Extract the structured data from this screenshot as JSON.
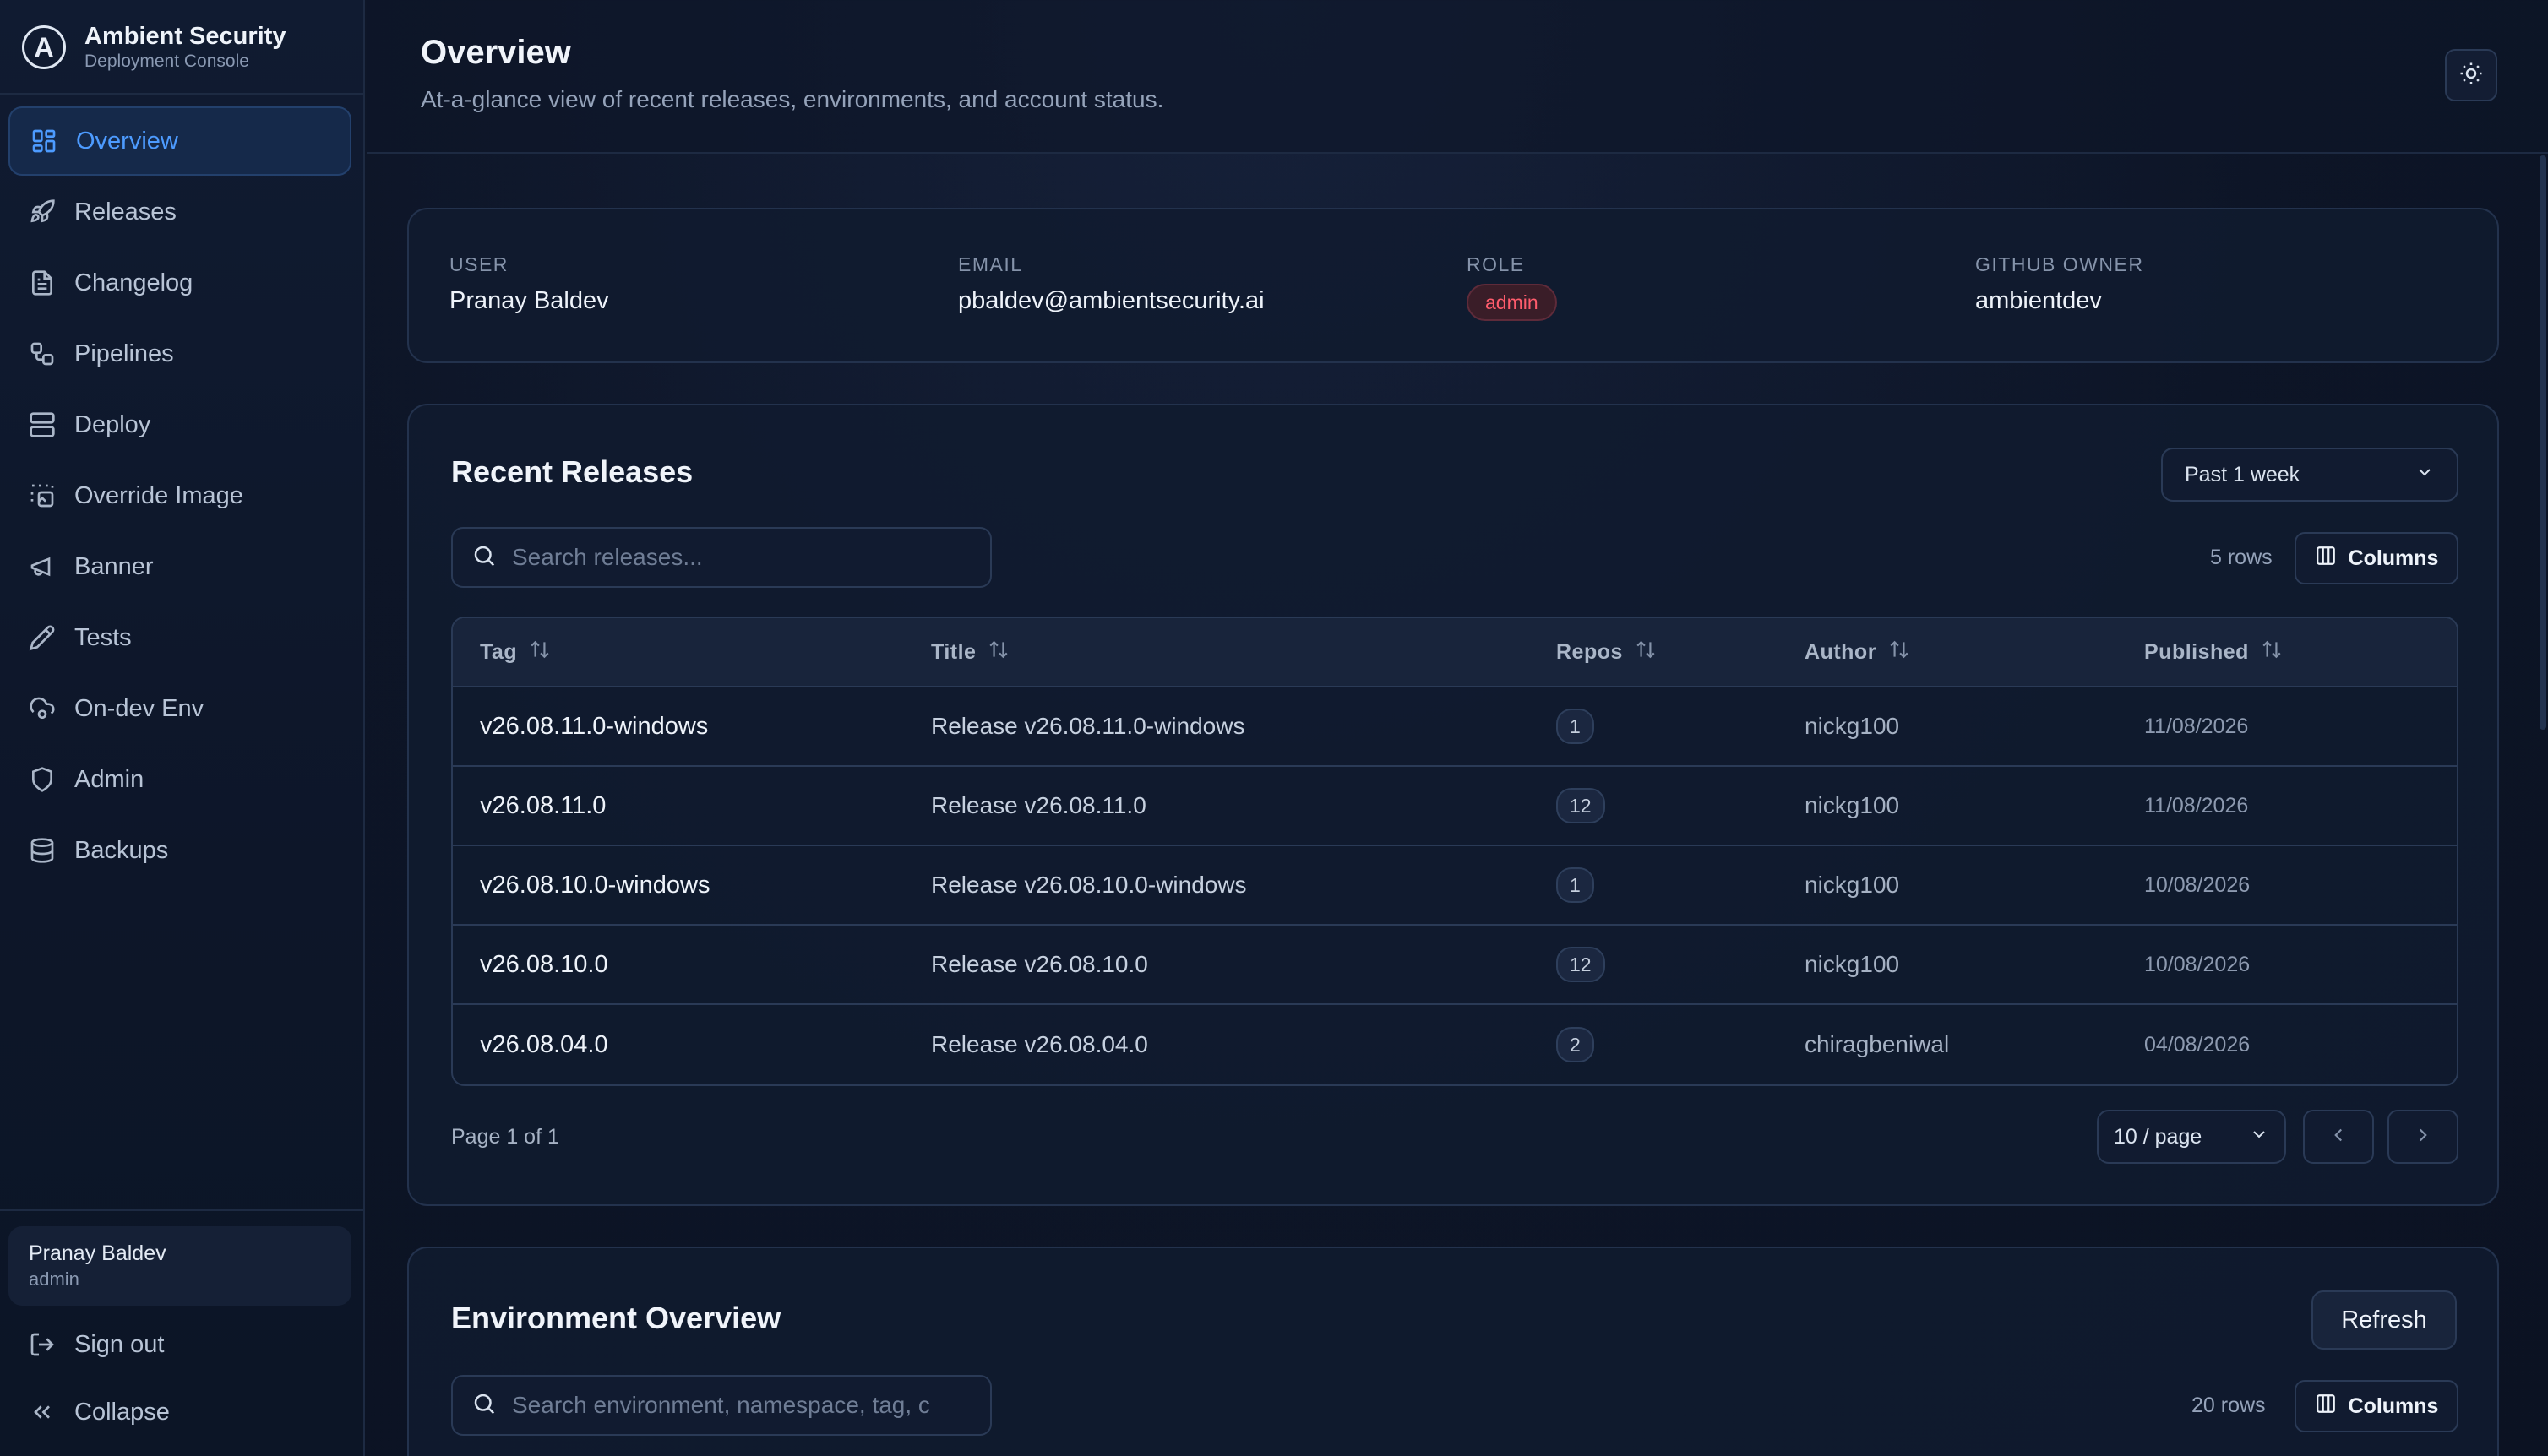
{
  "brand": {
    "logo_letter": "A",
    "name": "Ambient Security",
    "subtitle": "Deployment Console"
  },
  "sidebar": {
    "items": [
      {
        "label": "Overview",
        "icon": "grid-icon",
        "active": true
      },
      {
        "label": "Releases",
        "icon": "rocket-icon"
      },
      {
        "label": "Changelog",
        "icon": "file-text-icon"
      },
      {
        "label": "Pipelines",
        "icon": "workflow-icon"
      },
      {
        "label": "Deploy",
        "icon": "server-icon"
      },
      {
        "label": "Override Image",
        "icon": "image-select-icon"
      },
      {
        "label": "Banner",
        "icon": "megaphone-icon"
      },
      {
        "label": "Tests",
        "icon": "pencil-icon"
      },
      {
        "label": "On-dev Env",
        "icon": "cloud-cog-icon"
      },
      {
        "label": "Admin",
        "icon": "shield-icon"
      },
      {
        "label": "Backups",
        "icon": "database-icon"
      }
    ],
    "user": {
      "name": "Pranay Baldev",
      "role": "admin"
    },
    "sign_out": "Sign out",
    "collapse": "Collapse"
  },
  "header": {
    "title": "Overview",
    "subtitle": "At-a-glance view of recent releases, environments, and account status."
  },
  "account": {
    "user_label": "USER",
    "user_value": "Pranay Baldev",
    "email_label": "EMAIL",
    "email_value": "pbaldev@ambientsecurity.ai",
    "role_label": "ROLE",
    "role_value": "admin",
    "owner_label": "GITHUB OWNER",
    "owner_value": "ambientdev"
  },
  "releases": {
    "title": "Recent Releases",
    "range": "Past 1 week",
    "search_placeholder": "Search releases...",
    "row_count": "5 rows",
    "columns_label": "Columns",
    "headers": {
      "tag": "Tag",
      "title": "Title",
      "repos": "Repos",
      "author": "Author",
      "published": "Published"
    },
    "rows": [
      {
        "tag": "v26.08.11.0-windows",
        "title": "Release v26.08.11.0-windows",
        "repos": "1",
        "author": "nickg100",
        "published": "11/08/2026"
      },
      {
        "tag": "v26.08.11.0",
        "title": "Release v26.08.11.0",
        "repos": "12",
        "author": "nickg100",
        "published": "11/08/2026"
      },
      {
        "tag": "v26.08.10.0-windows",
        "title": "Release v26.08.10.0-windows",
        "repos": "1",
        "author": "nickg100",
        "published": "10/08/2026"
      },
      {
        "tag": "v26.08.10.0",
        "title": "Release v26.08.10.0",
        "repos": "12",
        "author": "nickg100",
        "published": "10/08/2026"
      },
      {
        "tag": "v26.08.04.0",
        "title": "Release v26.08.04.0",
        "repos": "2",
        "author": "chiragbeniwal",
        "published": "04/08/2026"
      }
    ],
    "page_text": "Page 1 of 1",
    "per_page": "10 / page"
  },
  "environments": {
    "title": "Environment Overview",
    "refresh_label": "Refresh",
    "search_placeholder": "Search environment, namespace, tag, c",
    "row_count": "20 rows",
    "columns_label": "Columns"
  },
  "colors": {
    "accent": "#4d9bff",
    "danger": "#ff5c6c",
    "background": "#0d1527"
  }
}
